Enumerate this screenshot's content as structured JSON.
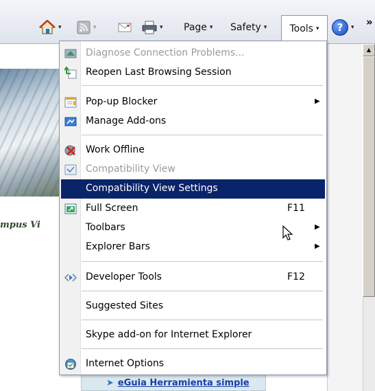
{
  "commandbar": {
    "page_label": "Page",
    "safety_label": "Safety",
    "tools_label": "Tools",
    "help_glyph": "?",
    "overflow_glyph": "»",
    "dropdown_glyph": "▾"
  },
  "menu": {
    "items": [
      {
        "label": "Diagnose Connection Problems...",
        "icon": "diagnose-icon",
        "disabled": true
      },
      {
        "label": "Reopen Last Browsing Session",
        "icon": "reopen-icon"
      },
      {
        "label": "Pop-up Blocker",
        "icon": "popup-blocker-icon",
        "submenu": true
      },
      {
        "label": "Manage Add-ons",
        "icon": "addons-icon"
      },
      {
        "label": "Work Offline",
        "icon": "offline-icon"
      },
      {
        "label": "Compatibility View",
        "icon": "compat-icon",
        "disabled": true
      },
      {
        "label": "Compatibility View Settings",
        "highlighted": true
      },
      {
        "label": "Full Screen",
        "icon": "fullscreen-icon",
        "shortcut": "F11"
      },
      {
        "label": "Toolbars",
        "submenu": true
      },
      {
        "label": "Explorer Bars",
        "submenu": true
      },
      {
        "label": "Developer Tools",
        "icon": "devtools-icon",
        "shortcut": "F12"
      },
      {
        "label": "Suggested Sites"
      },
      {
        "label": "Skype add-on for Internet Explorer"
      },
      {
        "label": "Internet Options",
        "icon": "options-icon"
      }
    ],
    "submenu_glyph": "▶"
  },
  "page": {
    "campus_text": "mpus Vi",
    "eguia_link": "eGuia Herramienta simple"
  },
  "colors": {
    "highlight": "#0a246a",
    "menu_border": "#8a96aa"
  }
}
